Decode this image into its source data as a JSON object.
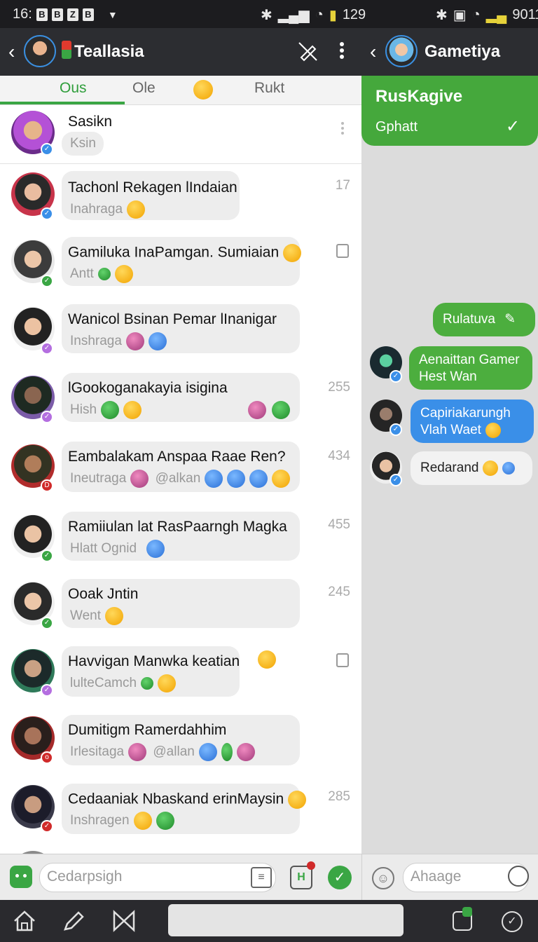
{
  "status_bar": {
    "time": "16:",
    "right_left": "129",
    "right_right": "9011"
  },
  "left_header": {
    "title": "Teallasia"
  },
  "right_header": {
    "title": "Gametiya"
  },
  "tabs": [
    {
      "label": "Ous"
    },
    {
      "label": "Ole"
    },
    {
      "label": "Rukt"
    }
  ],
  "chats": [
    {
      "name": "Sasikn",
      "sub": "Ksin",
      "count": ""
    },
    {
      "name": "Tachonl Rekagen lIndaian",
      "sub": "Inahraga",
      "count": "17"
    },
    {
      "name": "Gamiluka InaPamgan. Sumiaian",
      "sub": "Antt",
      "count": ""
    },
    {
      "name": "Wanicol Bsinan Pemar lInanigar",
      "sub": "Inshraga",
      "count": ""
    },
    {
      "name": "lGookoganakayia isigina",
      "sub": "Hish",
      "count": "255"
    },
    {
      "name": "Eambalakam Anspaa Raae Ren?",
      "sub": "Ineutraga",
      "sub2": "@alkan",
      "count": "434"
    },
    {
      "name": "Ramiiulan lat RasPaarngh Magka",
      "sub": "Hlatt  Ognid",
      "count": "455"
    },
    {
      "name": "Ooak Jntin",
      "sub": "Went",
      "count": "245"
    },
    {
      "name": "Havvigan Manwka keatian",
      "sub": "lulteCamch",
      "count": ""
    },
    {
      "name": "Dumitigm Ramerdahhim",
      "sub": "Irlesitaga",
      "sub2": "@allan",
      "count": ""
    },
    {
      "name": "Cedaaniak Nbaskand erinMaysin",
      "sub": "Inshragen",
      "count": "285"
    }
  ],
  "right_chat": {
    "card_title": "RusKagive",
    "card_sub": "Gphatt",
    "messages": [
      {
        "text": "Rulatuva"
      },
      {
        "text": "Aenaittan Gamer Hest Wan"
      },
      {
        "text": "Capiriakarungh Vlah Waet"
      },
      {
        "text": "Redarand"
      }
    ]
  },
  "left_input": {
    "placeholder": "Cedarpsigh"
  },
  "right_input": {
    "placeholder": "Ahaage"
  },
  "colors": {
    "accent_green": "#45a83c",
    "accent_blue": "#3a8fe8",
    "header_bg": "#2c2d31"
  }
}
